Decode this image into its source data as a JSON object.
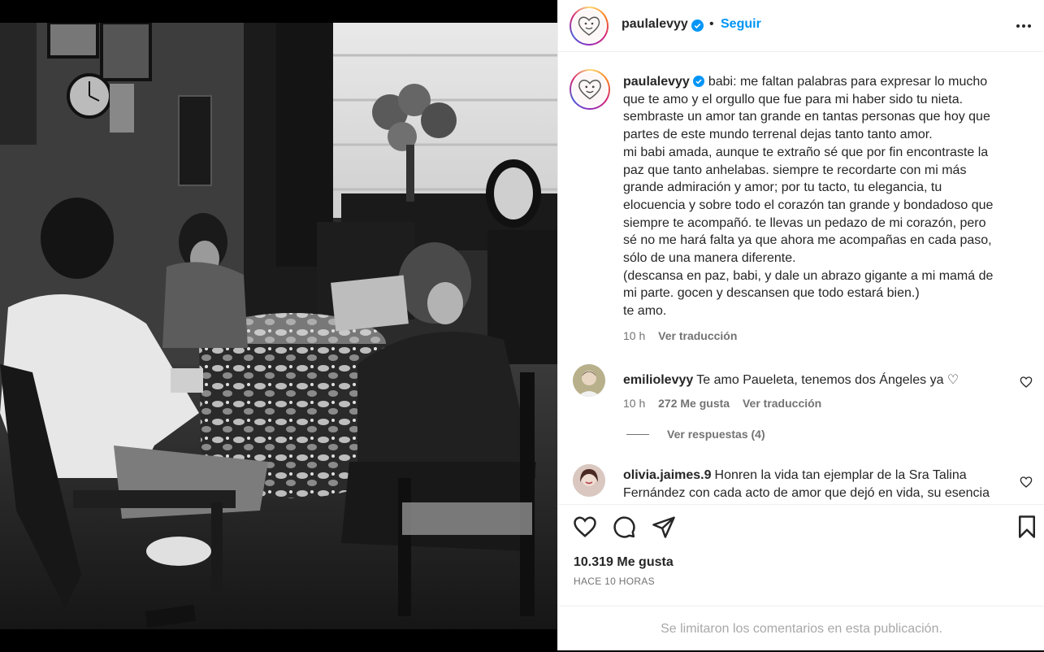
{
  "post": {
    "author": "paulalevyy",
    "follow_label": "Seguir",
    "separator": "•"
  },
  "caption": {
    "author": "paulalevyy",
    "text": "babi: me faltan palabras para expresar lo mucho\nque te amo y el orgullo que fue para mi haber sido tu nieta.\nsembraste un amor tan grande en tantas personas que hoy que\npartes de este mundo terrenal dejas tanto tanto amor.\nmi babi amada, aunque te extraño sé que por fin encontraste la\npaz que tanto anhelabas. siempre te recordarte con mi más\ngrande admiración y amor; por tu tacto, tu elegancia, tu\nelocuencia y sobre todo el corazón tan grande y bondadoso que\nsiempre te acompañó. te llevas un pedazo de mi corazón, pero\nsé no me hará falta ya que ahora me acompañas en cada paso,\nsólo de una manera diferente.\n(descansa en paz, babi, y dale un abrazo gigante a mi mamá de\nmi parte. gocen y descansen que todo estará bien.)\nte amo.",
    "time": "10 h",
    "translate": "Ver traducción"
  },
  "comments": [
    {
      "author": "emiliolevyy",
      "text": "Te amo Paueleta, tenemos dos Ángeles ya ♡",
      "time": "10 h",
      "likes": "272 Me gusta",
      "translate": "Ver traducción"
    },
    {
      "author": "olivia.jaimes.9",
      "text": "Honren la vida tan ejemplar de la Sra Talina Fernández con cada acto de amor que dejó en vida, su esencia"
    }
  ],
  "replies_label": "Ver respuestas (4)",
  "footer": {
    "likes": "10.319 Me gusta",
    "time_ago": "HACE 10 HORAS",
    "comments_limited": "Se limitaron los comentarios en esta publicación."
  },
  "icons": {
    "verified": "verified-badge-icon",
    "more": "more-options-icon",
    "like": "heart-icon",
    "comment": "comment-icon",
    "share": "share-icon",
    "save": "bookmark-icon"
  },
  "colors": {
    "accent": "#0095f6",
    "text": "#262626",
    "muted": "#737373",
    "disabled": "#a8a8a8"
  }
}
